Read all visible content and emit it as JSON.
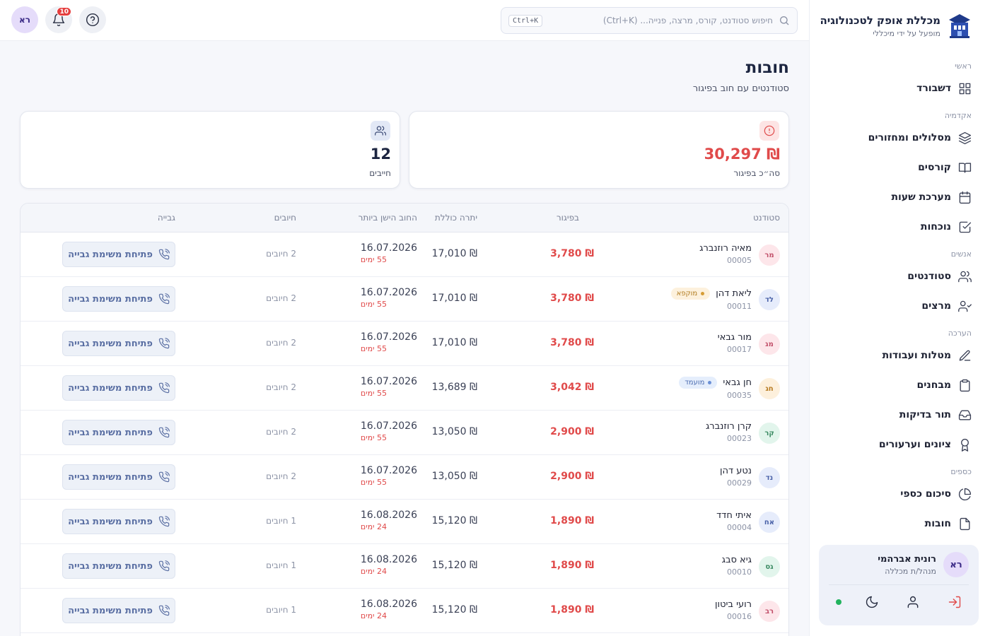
{
  "brand": {
    "name": "מכללת אופק לטכנולוגיה",
    "subtitle": "מופעל על ידי מיכללי"
  },
  "sidebar": {
    "sections": [
      {
        "title": "ראשי",
        "items": [
          {
            "label": "דשבורד",
            "icon": "grid-icon"
          }
        ]
      },
      {
        "title": "אקדמיה",
        "items": [
          {
            "label": "מסלולים ומחזורים",
            "icon": "layers-icon"
          },
          {
            "label": "קורסים",
            "icon": "book-icon"
          },
          {
            "label": "מערכת שעות",
            "icon": "calendar-icon"
          },
          {
            "label": "נוכחות",
            "icon": "checkbox-icon"
          }
        ]
      },
      {
        "title": "אנשים",
        "items": [
          {
            "label": "סטודנטים",
            "icon": "users-icon"
          },
          {
            "label": "מרצים",
            "icon": "user-check-icon"
          }
        ]
      },
      {
        "title": "הערכה",
        "items": [
          {
            "label": "מטלות ועבודות",
            "icon": "pencil-icon"
          },
          {
            "label": "מבחנים",
            "icon": "clipboard-icon"
          },
          {
            "label": "תור בדיקות",
            "icon": "inbox-icon"
          },
          {
            "label": "ציונים וערעורים",
            "icon": "award-icon"
          }
        ]
      },
      {
        "title": "כספים",
        "items": [
          {
            "label": "סיכום כספי",
            "icon": "pie-chart-icon"
          },
          {
            "label": "חובות",
            "icon": "file-icon"
          }
        ]
      }
    ]
  },
  "user": {
    "initials": "רא",
    "name": "רונית אברהמי",
    "role": "מנהל/ת מכללה"
  },
  "topbar": {
    "search_placeholder": "חיפוש סטודנט, קורס, מרצה, פנייה... (Ctrl+K)",
    "shortcut": "Ctrl+K",
    "notifications_count": "10",
    "avatar_initials": "רא"
  },
  "page": {
    "title": "חובות",
    "subtitle": "סטודנטים עם חוב בפיגור"
  },
  "stats": {
    "overdue_value": "₪ 30,297",
    "overdue_label": "סה״כ בפיגור",
    "debtors_value": "12",
    "debtors_label": "חייבים"
  },
  "table": {
    "headers": {
      "student": "סטודנט",
      "overdue": "בפיגור",
      "total_balance": "יתרה כוללת",
      "oldest_debt": "החוב הישן ביותר",
      "charges": "חיובים",
      "collection": "גבייה"
    },
    "action_label": "פתיחת משימת גבייה",
    "rows": [
      {
        "initials": "מר",
        "avatar_bg": "#fde6ea",
        "avatar_fg": "#c2506a",
        "name": "מאיה רוזנברג",
        "id": "00005",
        "tag": "",
        "tag_type": "",
        "overdue": "₪ 3,780",
        "balance": "₪ 17,010",
        "date": "16.07.2026",
        "days": "55 ימים",
        "charges": "2 חיובים"
      },
      {
        "initials": "לד",
        "avatar_bg": "#e6ecfb",
        "avatar_fg": "#4a62a8",
        "name": "ליאת דהן",
        "id": "00011",
        "tag": "מוקפא",
        "tag_type": "frozen",
        "overdue": "₪ 3,780",
        "balance": "₪ 17,010",
        "date": "16.07.2026",
        "days": "55 ימים",
        "charges": "2 חיובים"
      },
      {
        "initials": "מג",
        "avatar_bg": "#fde6ea",
        "avatar_fg": "#c2506a",
        "name": "מור גבאי",
        "id": "00017",
        "tag": "",
        "tag_type": "",
        "overdue": "₪ 3,780",
        "balance": "₪ 17,010",
        "date": "16.07.2026",
        "days": "55 ימים",
        "charges": "2 חיובים"
      },
      {
        "initials": "חג",
        "avatar_bg": "#fdf0dc",
        "avatar_fg": "#b67a20",
        "name": "חן גבאי",
        "id": "00035",
        "tag": "מועמד",
        "tag_type": "candidate",
        "overdue": "₪ 3,042",
        "balance": "₪ 13,689",
        "date": "16.07.2026",
        "days": "55 ימים",
        "charges": "2 חיובים"
      },
      {
        "initials": "קר",
        "avatar_bg": "#e2f5ec",
        "avatar_fg": "#3a8a62",
        "name": "קרן רוזנברג",
        "id": "00023",
        "tag": "",
        "tag_type": "",
        "overdue": "₪ 2,900",
        "balance": "₪ 13,050",
        "date": "16.07.2026",
        "days": "55 ימים",
        "charges": "2 חיובים"
      },
      {
        "initials": "נד",
        "avatar_bg": "#e6ecfb",
        "avatar_fg": "#4a62a8",
        "name": "נטע דהן",
        "id": "00029",
        "tag": "",
        "tag_type": "",
        "overdue": "₪ 2,900",
        "balance": "₪ 13,050",
        "date": "16.07.2026",
        "days": "55 ימים",
        "charges": "2 חיובים"
      },
      {
        "initials": "אח",
        "avatar_bg": "#e6ecfb",
        "avatar_fg": "#4a62a8",
        "name": "איתי חדד",
        "id": "00004",
        "tag": "",
        "tag_type": "",
        "overdue": "₪ 1,890",
        "balance": "₪ 15,120",
        "date": "16.08.2026",
        "days": "24 ימים",
        "charges": "1 חיובים"
      },
      {
        "initials": "גס",
        "avatar_bg": "#e2f5ec",
        "avatar_fg": "#3a8a62",
        "name": "גיא סבג",
        "id": "00010",
        "tag": "",
        "tag_type": "",
        "overdue": "₪ 1,890",
        "balance": "₪ 15,120",
        "date": "16.08.2026",
        "days": "24 ימים",
        "charges": "1 חיובים"
      },
      {
        "initials": "רב",
        "avatar_bg": "#fde6ea",
        "avatar_fg": "#c2506a",
        "name": "רועי ביטון",
        "id": "00016",
        "tag": "",
        "tag_type": "",
        "overdue": "₪ 1,890",
        "balance": "₪ 15,120",
        "date": "16.08.2026",
        "days": "24 ימים",
        "charges": "1 חיובים"
      }
    ]
  }
}
